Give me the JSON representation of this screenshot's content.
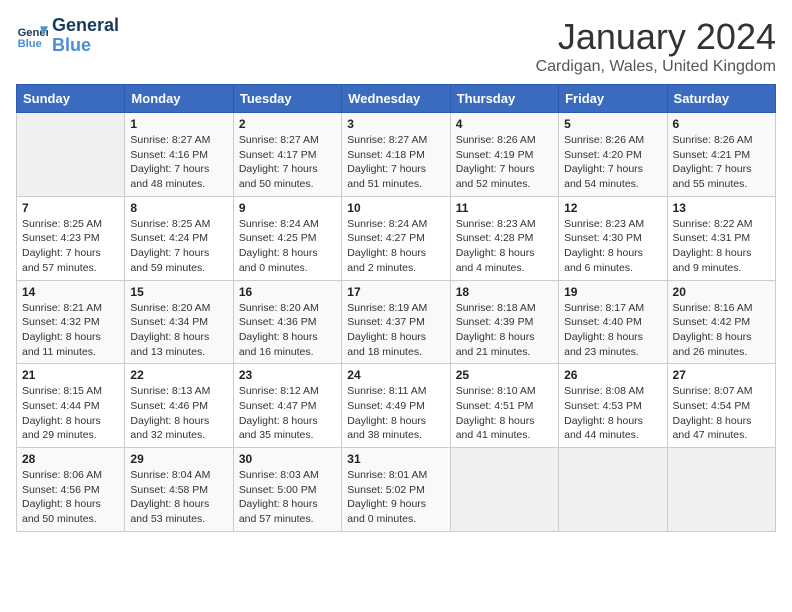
{
  "header": {
    "logo_line1": "General",
    "logo_line2": "Blue",
    "title": "January 2024",
    "subtitle": "Cardigan, Wales, United Kingdom"
  },
  "weekdays": [
    "Sunday",
    "Monday",
    "Tuesday",
    "Wednesday",
    "Thursday",
    "Friday",
    "Saturday"
  ],
  "weeks": [
    [
      {
        "day": "",
        "info": ""
      },
      {
        "day": "1",
        "info": "Sunrise: 8:27 AM\nSunset: 4:16 PM\nDaylight: 7 hours\nand 48 minutes."
      },
      {
        "day": "2",
        "info": "Sunrise: 8:27 AM\nSunset: 4:17 PM\nDaylight: 7 hours\nand 50 minutes."
      },
      {
        "day": "3",
        "info": "Sunrise: 8:27 AM\nSunset: 4:18 PM\nDaylight: 7 hours\nand 51 minutes."
      },
      {
        "day": "4",
        "info": "Sunrise: 8:26 AM\nSunset: 4:19 PM\nDaylight: 7 hours\nand 52 minutes."
      },
      {
        "day": "5",
        "info": "Sunrise: 8:26 AM\nSunset: 4:20 PM\nDaylight: 7 hours\nand 54 minutes."
      },
      {
        "day": "6",
        "info": "Sunrise: 8:26 AM\nSunset: 4:21 PM\nDaylight: 7 hours\nand 55 minutes."
      }
    ],
    [
      {
        "day": "7",
        "info": "Sunrise: 8:25 AM\nSunset: 4:23 PM\nDaylight: 7 hours\nand 57 minutes."
      },
      {
        "day": "8",
        "info": "Sunrise: 8:25 AM\nSunset: 4:24 PM\nDaylight: 7 hours\nand 59 minutes."
      },
      {
        "day": "9",
        "info": "Sunrise: 8:24 AM\nSunset: 4:25 PM\nDaylight: 8 hours\nand 0 minutes."
      },
      {
        "day": "10",
        "info": "Sunrise: 8:24 AM\nSunset: 4:27 PM\nDaylight: 8 hours\nand 2 minutes."
      },
      {
        "day": "11",
        "info": "Sunrise: 8:23 AM\nSunset: 4:28 PM\nDaylight: 8 hours\nand 4 minutes."
      },
      {
        "day": "12",
        "info": "Sunrise: 8:23 AM\nSunset: 4:30 PM\nDaylight: 8 hours\nand 6 minutes."
      },
      {
        "day": "13",
        "info": "Sunrise: 8:22 AM\nSunset: 4:31 PM\nDaylight: 8 hours\nand 9 minutes."
      }
    ],
    [
      {
        "day": "14",
        "info": "Sunrise: 8:21 AM\nSunset: 4:32 PM\nDaylight: 8 hours\nand 11 minutes."
      },
      {
        "day": "15",
        "info": "Sunrise: 8:20 AM\nSunset: 4:34 PM\nDaylight: 8 hours\nand 13 minutes."
      },
      {
        "day": "16",
        "info": "Sunrise: 8:20 AM\nSunset: 4:36 PM\nDaylight: 8 hours\nand 16 minutes."
      },
      {
        "day": "17",
        "info": "Sunrise: 8:19 AM\nSunset: 4:37 PM\nDaylight: 8 hours\nand 18 minutes."
      },
      {
        "day": "18",
        "info": "Sunrise: 8:18 AM\nSunset: 4:39 PM\nDaylight: 8 hours\nand 21 minutes."
      },
      {
        "day": "19",
        "info": "Sunrise: 8:17 AM\nSunset: 4:40 PM\nDaylight: 8 hours\nand 23 minutes."
      },
      {
        "day": "20",
        "info": "Sunrise: 8:16 AM\nSunset: 4:42 PM\nDaylight: 8 hours\nand 26 minutes."
      }
    ],
    [
      {
        "day": "21",
        "info": "Sunrise: 8:15 AM\nSunset: 4:44 PM\nDaylight: 8 hours\nand 29 minutes."
      },
      {
        "day": "22",
        "info": "Sunrise: 8:13 AM\nSunset: 4:46 PM\nDaylight: 8 hours\nand 32 minutes."
      },
      {
        "day": "23",
        "info": "Sunrise: 8:12 AM\nSunset: 4:47 PM\nDaylight: 8 hours\nand 35 minutes."
      },
      {
        "day": "24",
        "info": "Sunrise: 8:11 AM\nSunset: 4:49 PM\nDaylight: 8 hours\nand 38 minutes."
      },
      {
        "day": "25",
        "info": "Sunrise: 8:10 AM\nSunset: 4:51 PM\nDaylight: 8 hours\nand 41 minutes."
      },
      {
        "day": "26",
        "info": "Sunrise: 8:08 AM\nSunset: 4:53 PM\nDaylight: 8 hours\nand 44 minutes."
      },
      {
        "day": "27",
        "info": "Sunrise: 8:07 AM\nSunset: 4:54 PM\nDaylight: 8 hours\nand 47 minutes."
      }
    ],
    [
      {
        "day": "28",
        "info": "Sunrise: 8:06 AM\nSunset: 4:56 PM\nDaylight: 8 hours\nand 50 minutes."
      },
      {
        "day": "29",
        "info": "Sunrise: 8:04 AM\nSunset: 4:58 PM\nDaylight: 8 hours\nand 53 minutes."
      },
      {
        "day": "30",
        "info": "Sunrise: 8:03 AM\nSunset: 5:00 PM\nDaylight: 8 hours\nand 57 minutes."
      },
      {
        "day": "31",
        "info": "Sunrise: 8:01 AM\nSunset: 5:02 PM\nDaylight: 9 hours\nand 0 minutes."
      },
      {
        "day": "",
        "info": ""
      },
      {
        "day": "",
        "info": ""
      },
      {
        "day": "",
        "info": ""
      }
    ]
  ]
}
